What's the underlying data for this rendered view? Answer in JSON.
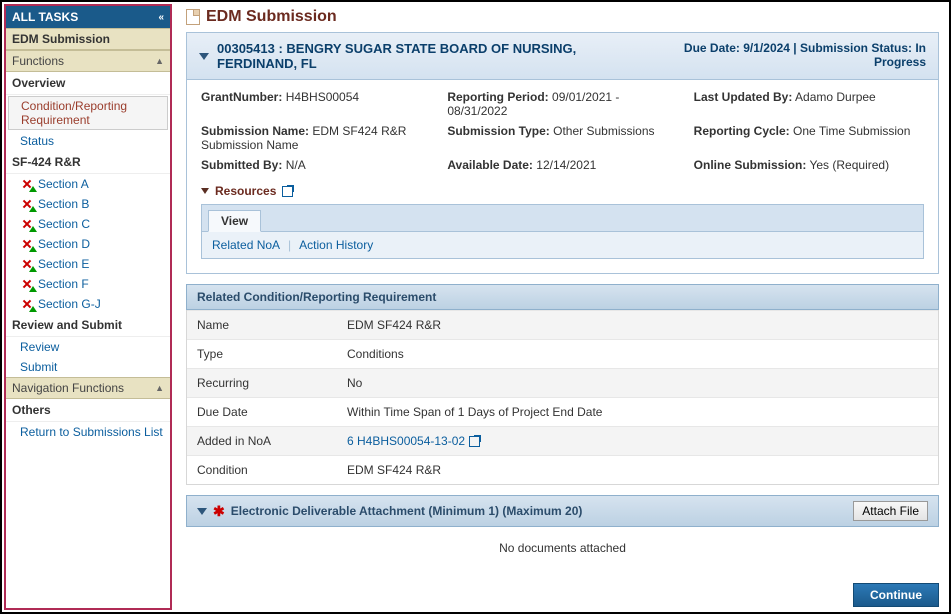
{
  "sidebar": {
    "header": "ALL TASKS",
    "edm_sub": "EDM Submission",
    "functions": "Functions",
    "overview": "Overview",
    "cond_req": "Condition/Reporting Requirement",
    "status": "Status",
    "sf424": "SF-424 R&R",
    "sections": {
      "a": "Section A",
      "b": "Section B",
      "c": "Section C",
      "d": "Section D",
      "e": "Section E",
      "f": "Section F",
      "gj": "Section G-J"
    },
    "review_submit": "Review and Submit",
    "review": "Review",
    "submit": "Submit",
    "nav_funcs": "Navigation Functions",
    "others": "Others",
    "return": "Return to Submissions List"
  },
  "page": {
    "title": "EDM Submission",
    "grant_id_line": "00305413 : BENGRY SUGAR STATE BOARD OF NURSING, FERDINAND, FL",
    "due_line": "Due Date: 9/1/2024 | Submission Status: In Progress"
  },
  "details": {
    "grant_number_lbl": "GrantNumber:",
    "grant_number_val": "H4BHS00054",
    "reporting_period_lbl": "Reporting Period:",
    "reporting_period_val": "09/01/2021 - 08/31/2022",
    "last_updated_lbl": "Last Updated By:",
    "last_updated_val": "Adamo Durpee",
    "sub_name_lbl": "Submission Name:",
    "sub_name_val": "EDM SF424 R&R Submission Name",
    "sub_type_lbl": "Submission Type:",
    "sub_type_val": "Other Submissions",
    "rep_cycle_lbl": "Reporting Cycle:",
    "rep_cycle_val": "One Time Submission",
    "submitted_by_lbl": "Submitted By:",
    "submitted_by_val": "N/A",
    "available_date_lbl": "Available Date:",
    "available_date_val": "12/14/2021",
    "online_sub_lbl": "Online Submission:",
    "online_sub_val": "Yes (Required)"
  },
  "resources": {
    "title": "Resources",
    "tab_view": "View",
    "related_noa": "Related NoA",
    "action_history": "Action History"
  },
  "condition_section": {
    "title": "Related Condition/Reporting Requirement",
    "rows": {
      "name_k": "Name",
      "name_v": "EDM SF424 R&R",
      "type_k": "Type",
      "type_v": "Conditions",
      "recurring_k": "Recurring",
      "recurring_v": "No",
      "due_k": "Due Date",
      "due_v": "Within Time Span of 1 Days of Project End Date",
      "added_k": "Added in NoA",
      "added_v": "6 H4BHS00054-13-02",
      "cond_k": "Condition",
      "cond_v": "EDM SF424 R&R"
    }
  },
  "attachment": {
    "title": "Electronic Deliverable Attachment (Minimum 1) (Maximum 20)",
    "attach_btn": "Attach File",
    "no_docs": "No documents attached"
  },
  "buttons": {
    "continue": "Continue"
  }
}
